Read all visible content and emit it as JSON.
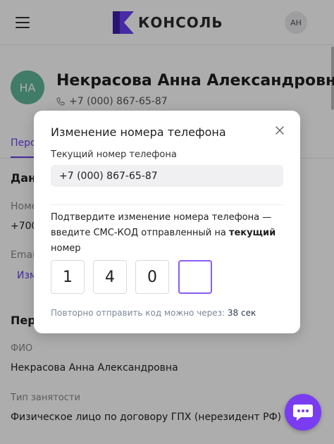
{
  "header": {
    "logo_text": "КОНСОЛЬ",
    "user_initials": "АН",
    "brand_color": "#6b3ff2"
  },
  "profile": {
    "initials": "НА",
    "name": "Некрасова Анна Александровна",
    "phone": "+7 (000) 867-65-87",
    "tab_partial": "Перс",
    "section_partial": "Данн",
    "phone_label_partial": "Номе",
    "phone_value_partial": "+700",
    "email_label_partial": "Email",
    "change_link_partial": "Изм",
    "personal_section_partial": "Перс",
    "fio_label": "ФИО",
    "fio_value": "Некрасова Анна Александровна",
    "employment_label": "Тип занятости",
    "employment_value": "Физическое лицо по договору ГПХ (нерезидент РФ)"
  },
  "modal": {
    "title": "Изменение номера телефона",
    "current_label": "Текущий номер телефона",
    "current_value": "+7 (000) 867-65-87",
    "confirm_text_1": "Подтвердите изменение номера телефона — введите СМС-КОД отправленный на ",
    "confirm_text_bold": "текущий",
    "confirm_text_2": " номер",
    "code_digits": [
      "1",
      "4",
      "0",
      ""
    ],
    "resend_text": "Повторно отправить код можно через: ",
    "resend_timer": "38 сек"
  },
  "icons": {
    "menu": "hamburger-icon",
    "phone": "phone-icon",
    "close": "close-icon",
    "chat": "chat-icon"
  },
  "colors": {
    "accent": "#6b3ff2",
    "avatar_green": "#5fb79a",
    "chat_button": "#7a3cf0"
  }
}
